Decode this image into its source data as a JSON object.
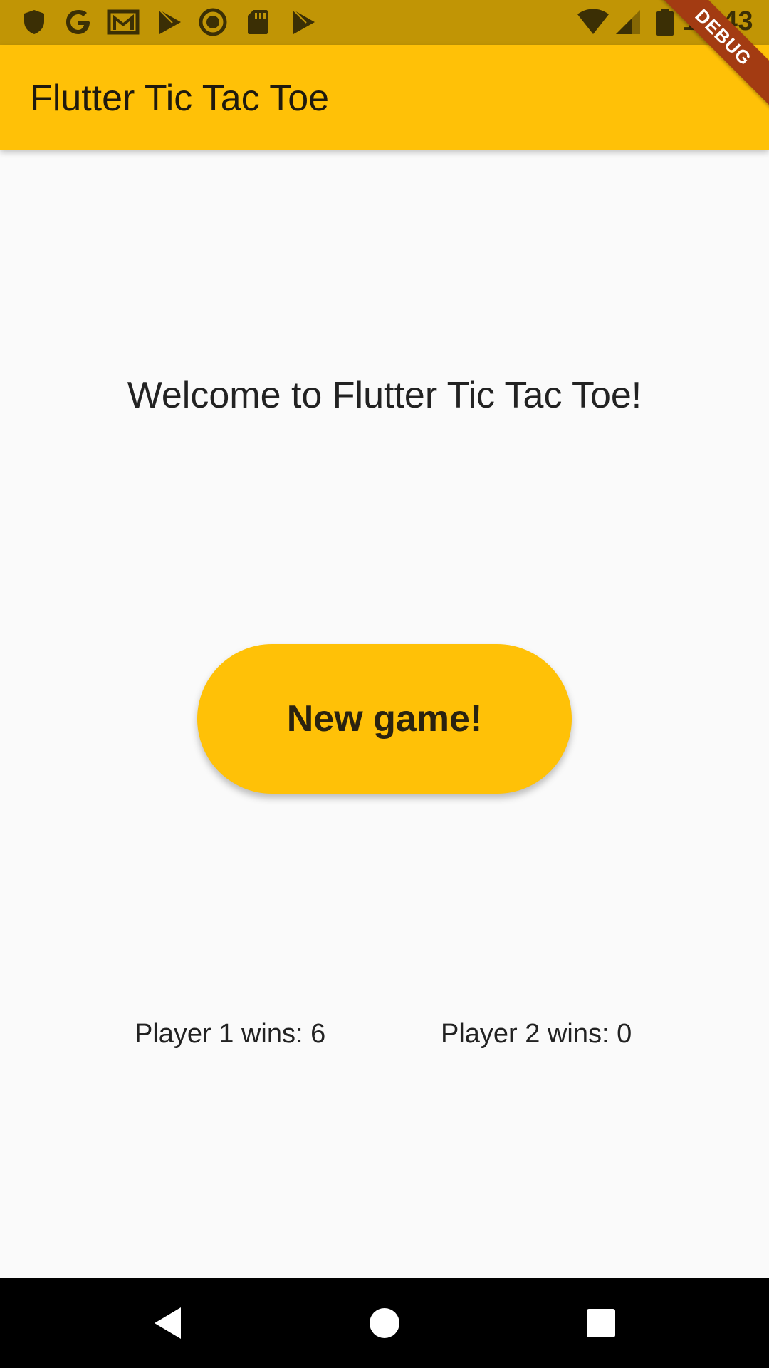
{
  "status_bar": {
    "time": "12:43",
    "icons_left": [
      "shield-icon",
      "google-icon",
      "gmail-icon",
      "play-store-icon",
      "record-icon",
      "sd-card-icon",
      "play-store-icon"
    ],
    "icons_right": [
      "wifi-icon",
      "signal-icon",
      "battery-icon"
    ]
  },
  "app_bar": {
    "title": "Flutter Tic Tac Toe"
  },
  "debug_banner": "DEBUG",
  "main": {
    "welcome_text": "Welcome to Flutter Tic Tac Toe!",
    "new_game_label": "New game!",
    "player1_score": "Player 1 wins: 6",
    "player2_score": "Player 2 wins: 0"
  },
  "nav_bar": {
    "buttons": [
      "back-icon",
      "home-icon",
      "recents-icon"
    ]
  },
  "colors": {
    "status_bar": "#c19505",
    "app_bar": "#ffc107",
    "button": "#ffc107",
    "background": "#fafafa",
    "nav_bar": "#000000",
    "debug_ribbon": "#a33b12"
  }
}
